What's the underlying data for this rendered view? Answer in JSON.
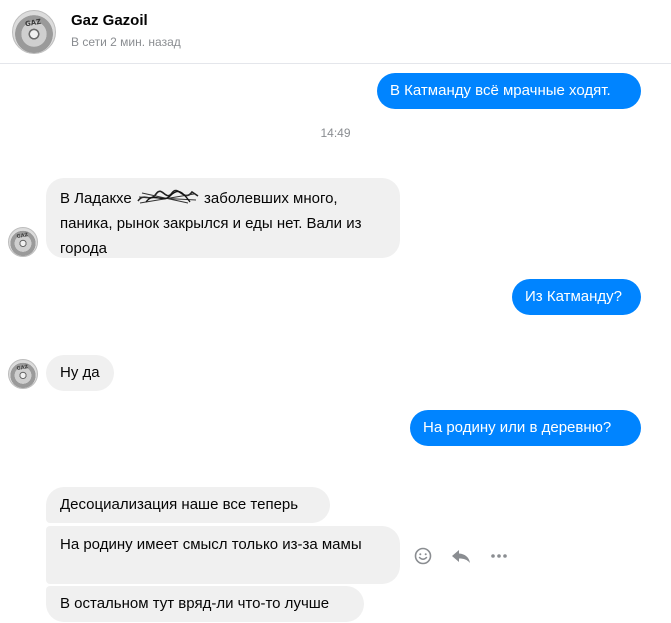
{
  "header": {
    "name": "Gaz Gazoil",
    "status": "В сети 2 мин. назад",
    "avatar_text": "GAZ"
  },
  "timestamp": "14:49",
  "messages": [
    {
      "from": "me",
      "text": "В Катманду всё мрачные ходят."
    },
    {
      "from": "them",
      "text_before": "В Ладакхе",
      "text_after": "заболевших много, паника, рынок закрылся и еды нет. Вали из города"
    },
    {
      "from": "me",
      "text": "Из Катманду?"
    },
    {
      "from": "them",
      "text": "Ну да"
    },
    {
      "from": "me",
      "text": "На родину или в деревню?"
    },
    {
      "from": "them",
      "text": "Десоциализация наше все теперь"
    },
    {
      "from": "them",
      "text": "На родину имеет смысл только из-за мамы"
    },
    {
      "from": "them",
      "text": "В остальном тут вряд-ли что-то лучше"
    }
  ],
  "actions": [
    "emoji-icon",
    "reply-icon",
    "more-icon"
  ],
  "colors": {
    "outgoing": "#0084ff",
    "incoming": "#f0f0f0",
    "muted": "#8a8d91"
  }
}
